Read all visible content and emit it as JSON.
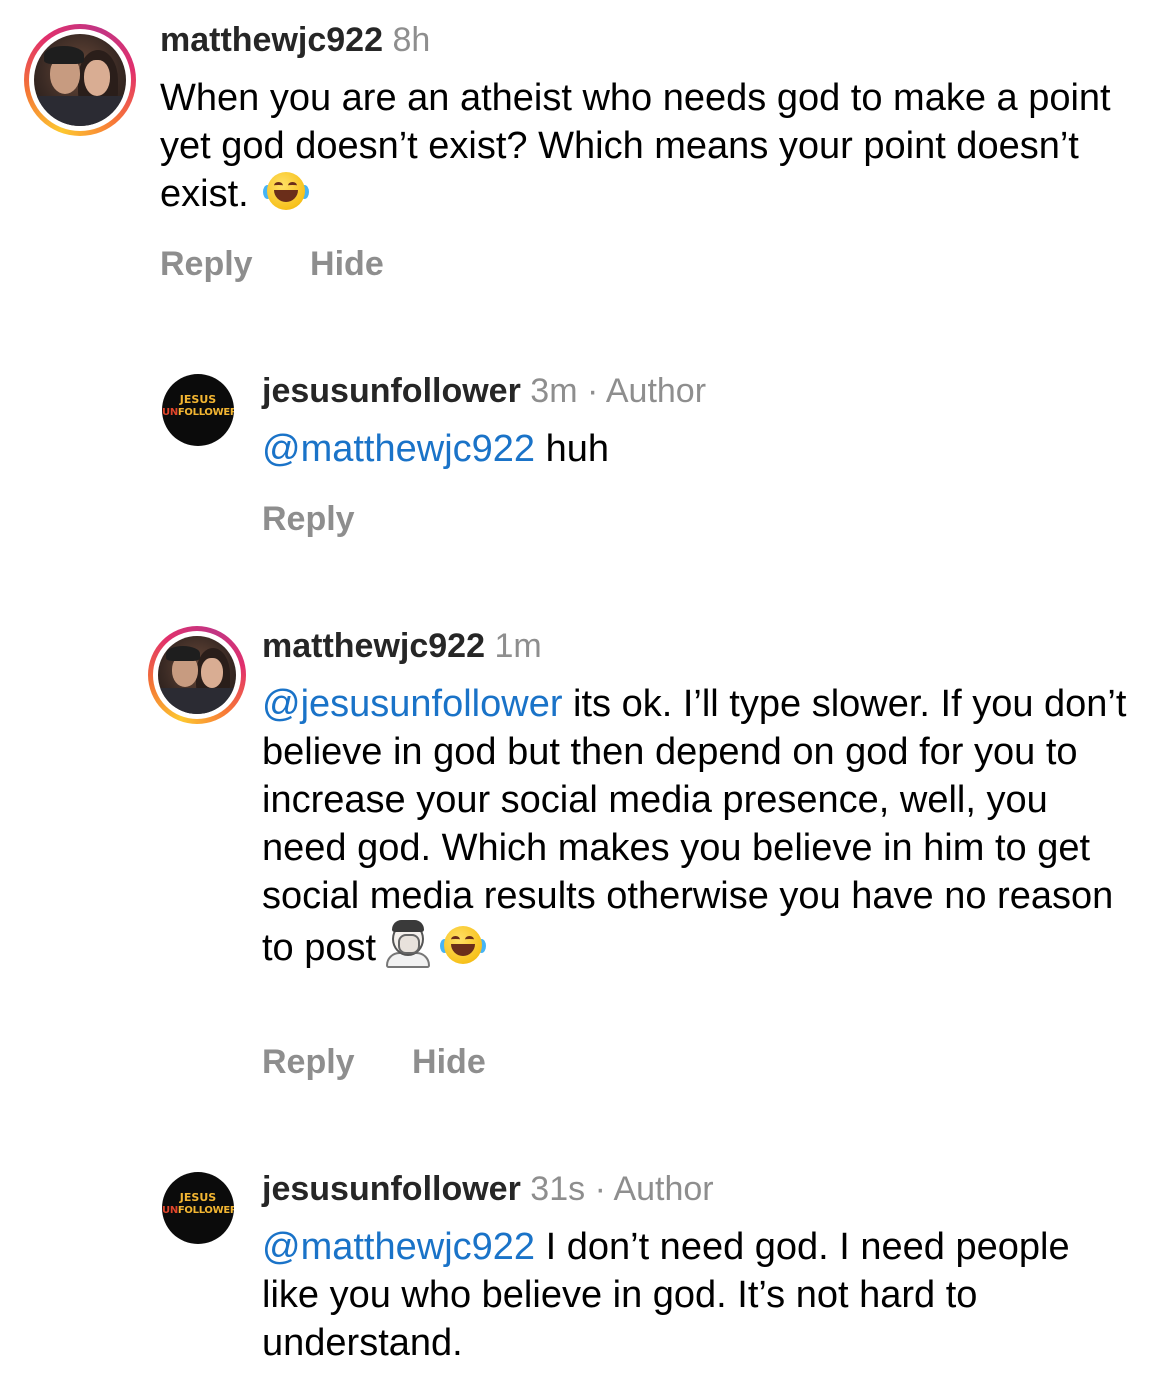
{
  "comments": [
    {
      "username": "matthewjc922",
      "time": "8h",
      "author_tag": "",
      "mention": "",
      "text": "When you are an atheist who needs god to make a point yet god doesn’t exist? Which means your point doesn’t exist.",
      "emojis": [
        "face-with-tears-of-joy"
      ],
      "actions": [
        "Reply",
        "Hide"
      ]
    },
    {
      "username": "jesusunfollower",
      "time": "3m",
      "author_tag": "· Author",
      "mention": "@matthewjc922",
      "text": " huh",
      "avatar_logo": [
        "JESUS",
        "UN",
        "FOLLOWER"
      ],
      "actions": [
        "Reply"
      ]
    },
    {
      "username": "matthewjc922",
      "time": "1m",
      "author_tag": "",
      "mention": "@jesusunfollower",
      "text": " its ok. I’ll type slower. If you don’t believe in god but then depend on god for you to increase your social media presence, well, you need god. Which makes you believe in him to get social media results otherwise you have no reason to post",
      "emojis": [
        "person-facepalming",
        "face-with-tears-of-joy"
      ],
      "actions": [
        "Reply",
        "Hide"
      ]
    },
    {
      "username": "jesusunfollower",
      "time": "31s",
      "author_tag": "· Author",
      "mention": "@matthewjc922",
      "text": " I don’t need god. I need people like you who believe in god. It’s not hard to understand.",
      "avatar_logo": [
        "JESUS",
        "UN",
        "FOLLOWER"
      ],
      "actions": []
    }
  ],
  "colors": {
    "mention": "#1a73c8",
    "meta": "#8e8e8e",
    "logo_gold": "#f3b632",
    "logo_red": "#e0452b"
  }
}
